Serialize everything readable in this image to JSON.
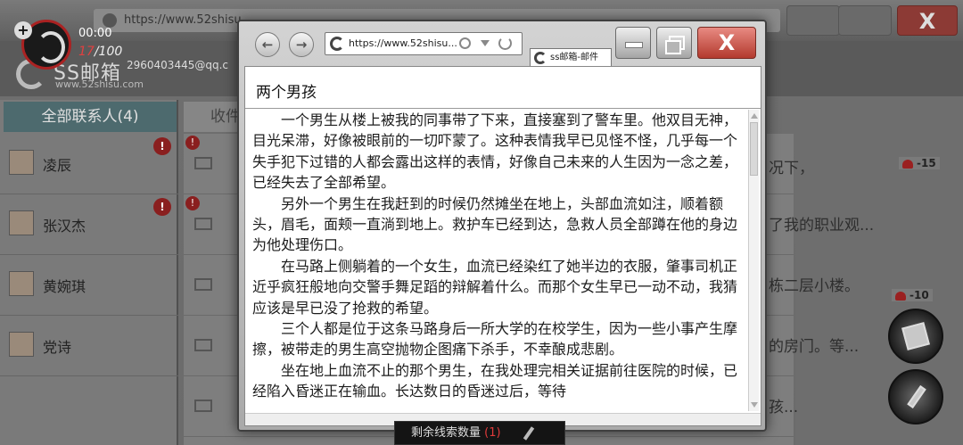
{
  "hud": {
    "timer": "00:00",
    "count_current": "17",
    "count_total": "/100"
  },
  "background": {
    "address_url": "https://www.52shisu",
    "brand": "SS邮箱",
    "brand_url": "www.52shisu.com",
    "email": "2960403445@qq.c",
    "contacts_tab": "全部联系人(4)",
    "mail_tab": "收件",
    "contacts": [
      {
        "name": "凌辰",
        "alert": "!"
      },
      {
        "name": "张汉杰",
        "alert": "!"
      },
      {
        "name": "黄婉琪",
        "alert": ""
      },
      {
        "name": "党诗",
        "alert": ""
      }
    ],
    "snippets": [
      "况下，",
      "了我的职业观...",
      "栋二层小楼。",
      "的房门。等...",
      "孩..."
    ],
    "cost_tags": [
      "-15",
      "-10"
    ]
  },
  "browser": {
    "url": "https://www.52shisu...",
    "tab_label": "ss邮箱-邮件",
    "close_label": "X"
  },
  "mail": {
    "subject": "两个男孩",
    "paragraphs": [
      "一个男生从楼上被我的同事带了下来，直接塞到了警车里。他双目无神，目光呆滞，好像被眼前的一切吓蒙了。这种表情我早已见怪不怪，几乎每一个失手犯下过错的人都会露出这样的表情，好像自己未来的人生因为一念之差，已经失去了全部希望。",
      "另外一个男生在我赶到的时候仍然摊坐在地上，头部血流如注，顺着额头，眉毛，面颊一直淌到地上。救护车已经到达，急救人员全部蹲在他的身边为他处理伤口。",
      "在马路上侧躺着的一个女生，血流已经染红了她半边的衣服，肇事司机正近乎疯狂般地向交警手舞足蹈的辩解着什么。而那个女生早已一动不动，我猜应该是早已没了抢救的希望。",
      "三个人都是位于这条马路身后一所大学的在校学生，因为一些小事产生摩擦，被带走的男生高空抛物企图痛下杀手，不幸酿成悲剧。",
      "坐在地上血流不止的那个男生，在我处理完相关证据前往医院的时候，已经陷入昏迷正在输血。长达数日的昏迷过后，等待"
    ]
  },
  "clues": {
    "label": "剩余线索数量",
    "count": "(1)"
  }
}
